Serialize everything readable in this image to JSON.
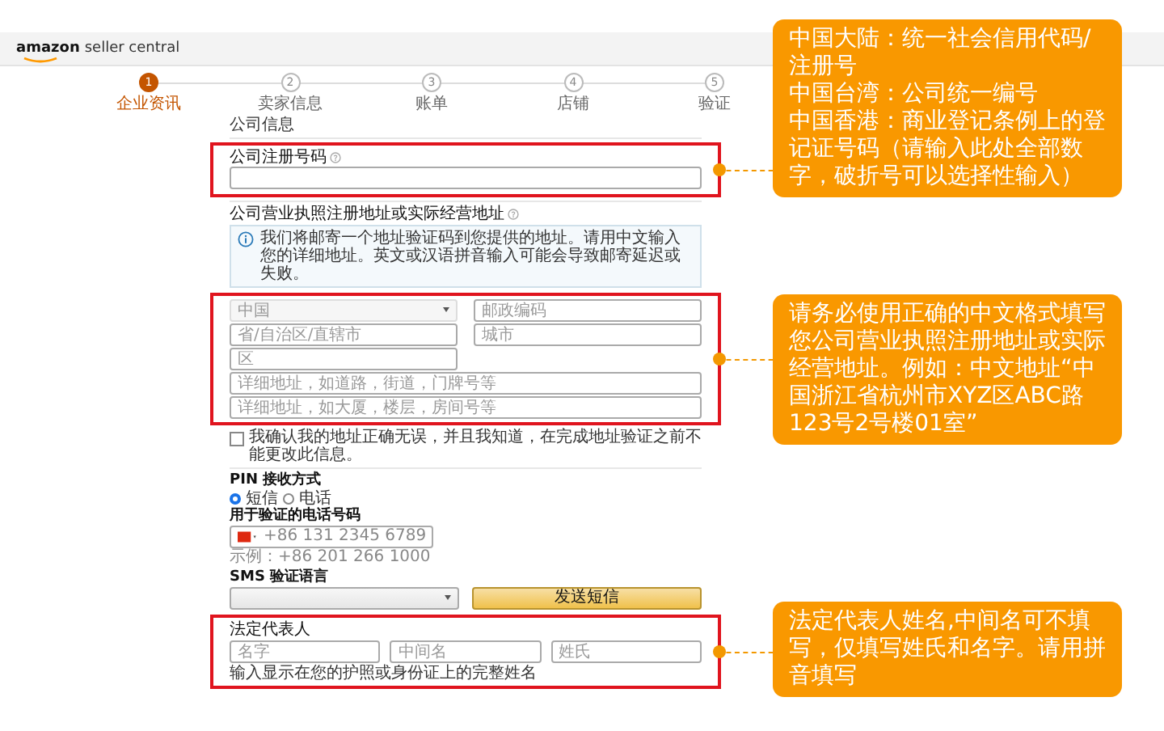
{
  "header": {
    "brand": "amazon",
    "product": "seller central"
  },
  "steps": [
    {
      "number": "1",
      "label": "企业资讯",
      "selected": true
    },
    {
      "number": "2",
      "label": "卖家信息",
      "selected": false
    },
    {
      "number": "3",
      "label": "账单",
      "selected": false
    },
    {
      "number": "4",
      "label": "店铺",
      "selected": false
    },
    {
      "number": "5",
      "label": "验证",
      "selected": false
    }
  ],
  "section_title": "公司信息",
  "registration": {
    "label": "公司注册号码"
  },
  "address": {
    "label": "公司营业执照注册地址或实际经营地址",
    "notice": "我们将邮寄一个地址验证码到您提供的地址。请用中文输入您的详细地址。英文或汉语拼音输入可能会导致邮寄延迟或失败。",
    "fields": [
      {
        "kind": "select",
        "placeholder": "中国",
        "disabled": true
      },
      {
        "kind": "input",
        "placeholder": "邮政编码",
        "disabled": false
      },
      {
        "kind": "input",
        "placeholder": "省/自治区/直辖市",
        "disabled": false
      },
      {
        "kind": "input",
        "placeholder": "城市",
        "disabled": false
      },
      {
        "kind": "input",
        "placeholder": "区",
        "disabled": false
      },
      {
        "kind": "address-line",
        "placeholder": "详细地址，如道路，街道，门牌号等",
        "disabled": false
      },
      {
        "kind": "address-line",
        "placeholder": "详细地址，如大厦，楼层，房间号等",
        "disabled": false
      }
    ]
  },
  "confirm": {
    "label": "我确认我的地址正确无误，并且我知道，在完成地址验证之前不能更改此信息。",
    "checked": false
  },
  "pin": {
    "label": "PIN 接收方式",
    "options": [
      {
        "label": "短信",
        "selected": true
      },
      {
        "label": "电话",
        "selected": false
      }
    ]
  },
  "phone": {
    "label": "用于验证的电话号码",
    "placeholder": "+86 131 2345 6789",
    "example": "示例：+86 201 266 1000"
  },
  "sms": {
    "label": "SMS 验证语言",
    "button": "发送短信"
  },
  "legal": {
    "label": "法定代表人",
    "fields": [
      {
        "placeholder": "名字"
      },
      {
        "placeholder": "中间名"
      },
      {
        "placeholder": "姓氏"
      }
    ],
    "note": "输入显示在您的护照或身份证上的完整姓名"
  },
  "callouts": [
    {
      "lines": [
        "中国大陆：统一社会信用代码/注册号",
        "中国台湾：公司统一编号",
        "中国香港：商业登记条例上的登记证号码（请输入此处全部数字，破折号可以选择性输入）"
      ]
    },
    {
      "lines": [
        "请务必使用正确的中文格式填写您公司营业执照注册地址或实际经营地址。例如：中文地址“中国浙江省杭州市XYZ区ABC路123号2号楼01室”"
      ]
    },
    {
      "lines": [
        "法定代表人姓名,中间名可不填写，仅填写姓氏和名字。请用拼音填写"
      ]
    }
  ]
}
